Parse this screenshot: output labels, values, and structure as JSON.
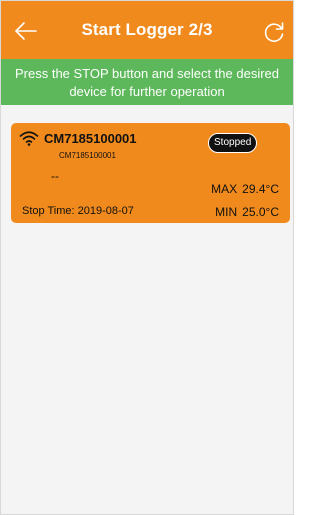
{
  "header": {
    "title": "Start Logger 2/3",
    "back_icon": "arrow-left-icon",
    "refresh_icon": "refresh-icon"
  },
  "banner": {
    "message": "Press the STOP button and select the desired device for further operation"
  },
  "devices": [
    {
      "name": "CM7185100001",
      "id": "CM7185100001",
      "status": "Stopped",
      "current_reading": "--",
      "stop_time_label": "Stop Time:",
      "stop_time": "2019-08-07",
      "max_label": "MAX",
      "max_value": "29.4°C",
      "min_label": "MIN",
      "min_value": "25.0°C",
      "signal_icon": "wifi-icon"
    }
  ],
  "colors": {
    "header": "#f18a1c",
    "banner": "#5cb85a",
    "card": "#f18a1c",
    "background": "#f4f4f4"
  }
}
